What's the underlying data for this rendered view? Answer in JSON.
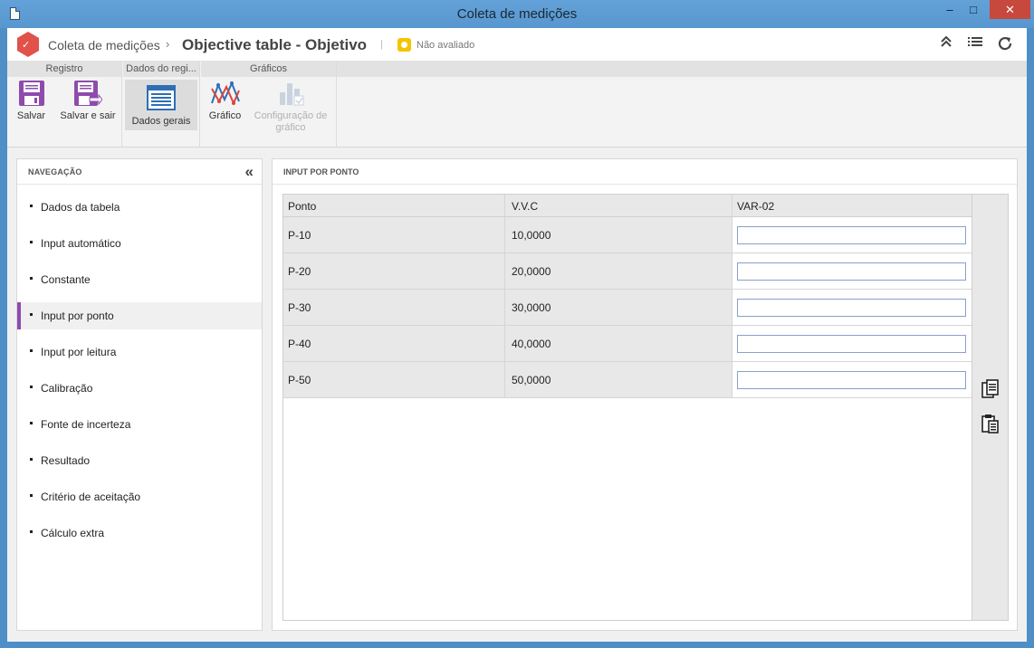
{
  "window": {
    "title": "Coleta de medições",
    "min": "–",
    "max": "□",
    "close": "✕"
  },
  "header": {
    "breadcrumb_parent": "Coleta de medições",
    "breadcrumb_sep": "›",
    "title": "Objective table - Objetivo",
    "separator": "|",
    "status": "Não avaliado",
    "status_color": "#f2c500",
    "icons": [
      "collapse-up-icon",
      "list-icon",
      "refresh-icon"
    ]
  },
  "ribbon": {
    "groups": [
      {
        "label": "Registro"
      },
      {
        "label": "Dados do regi..."
      },
      {
        "label": "Gráficos"
      }
    ],
    "buttons": {
      "save": "Salvar",
      "save_exit": "Salvar e sair",
      "general_data": "Dados gerais",
      "chart": "Gráfico",
      "chart_config": "Configuração de gráfico"
    }
  },
  "nav": {
    "title": "NAVEGAÇÃO",
    "collapse": "«",
    "items": [
      {
        "label": "Dados da tabela"
      },
      {
        "label": "Input automático"
      },
      {
        "label": "Constante"
      },
      {
        "label": "Input por ponto"
      },
      {
        "label": "Input por leitura"
      },
      {
        "label": "Calibração"
      },
      {
        "label": "Fonte de incerteza"
      },
      {
        "label": "Resultado"
      },
      {
        "label": "Critério de aceitação"
      },
      {
        "label": "Cálculo extra"
      }
    ],
    "active_index": 3,
    "accent": "#8e4bac"
  },
  "main": {
    "title": "INPUT POR PONTO",
    "table": {
      "columns": [
        "Ponto",
        "V.V.C",
        "VAR-02"
      ],
      "rows": [
        {
          "ponto": "P-10",
          "vvc": "10,0000",
          "var02": ""
        },
        {
          "ponto": "P-20",
          "vvc": "20,0000",
          "var02": ""
        },
        {
          "ponto": "P-30",
          "vvc": "30,0000",
          "var02": ""
        },
        {
          "ponto": "P-40",
          "vvc": "40,0000",
          "var02": ""
        },
        {
          "ponto": "P-50",
          "vvc": "50,0000",
          "var02": ""
        }
      ]
    },
    "side_icons": [
      "copy-icon",
      "paste-icon"
    ]
  }
}
